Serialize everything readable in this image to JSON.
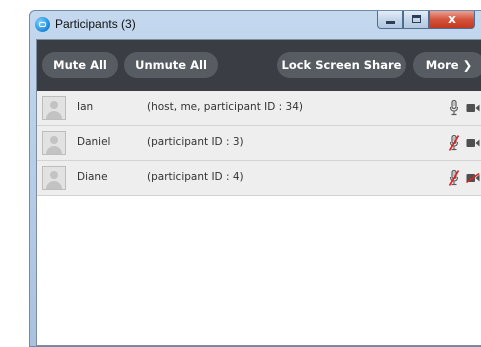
{
  "window": {
    "title": "Participants (3)",
    "close_label": "x"
  },
  "toolbar": {
    "mute_all": "Mute All",
    "unmute_all": "Unmute All",
    "lock_screen_share": "Lock Screen Share",
    "more": "More ❯"
  },
  "participants": [
    {
      "name": "Ian",
      "details": "(host, me, participant ID : 34)",
      "mic": "mic-icon",
      "video": "video-camera-icon",
      "mic_muted": false,
      "video_off": false
    },
    {
      "name": "Daniel",
      "details": "(participant ID : 3)",
      "mic": "mic-muted-icon",
      "video": "video-camera-icon",
      "mic_muted": true,
      "video_off": false
    },
    {
      "name": "Diane",
      "details": "(participant ID : 4)",
      "mic": "mic-muted-icon",
      "video": "video-camera-off-icon",
      "mic_muted": true,
      "video_off": true
    }
  ],
  "colors": {
    "toolbar_bg": "#3a3e44",
    "button_bg": "#575c63",
    "row_bg": "#eeeeee",
    "muted_slash": "#e02020",
    "icon": "#5a5a5a"
  }
}
